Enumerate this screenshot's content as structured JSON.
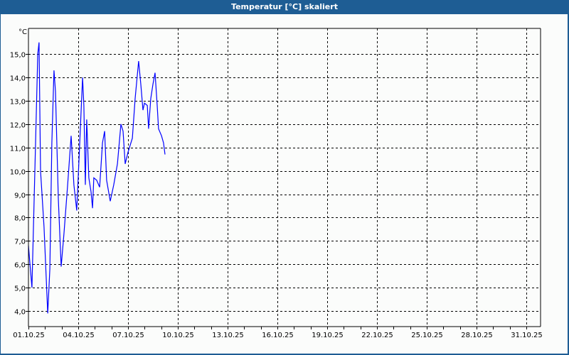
{
  "window": {
    "title": "Temperatur [°C] skaliert"
  },
  "chart_data": {
    "type": "line",
    "title": "Temperatur [°C] skaliert",
    "ylabel": "°C",
    "xlabel": "",
    "x_unit": "days since 01.10.25",
    "xlim": [
      0,
      30.86
    ],
    "ylim": [
      3.33,
      16.1
    ],
    "grid": true,
    "y_ticks": [
      {
        "value": 4,
        "label": "4,0"
      },
      {
        "value": 5,
        "label": "5,0"
      },
      {
        "value": 6,
        "label": "6,0"
      },
      {
        "value": 7,
        "label": "7,0"
      },
      {
        "value": 8,
        "label": "8,0"
      },
      {
        "value": 9,
        "label": "9,0"
      },
      {
        "value": 10,
        "label": "10,0"
      },
      {
        "value": 11,
        "label": "11,0"
      },
      {
        "value": 12,
        "label": "12,0"
      },
      {
        "value": 13,
        "label": "13,0"
      },
      {
        "value": 14,
        "label": "14,0"
      },
      {
        "value": 15,
        "label": "15,0"
      }
    ],
    "x_ticks": [
      {
        "value": 0,
        "label": "01.10.25"
      },
      {
        "value": 3,
        "label": "04.10.25"
      },
      {
        "value": 6,
        "label": "07.10.25"
      },
      {
        "value": 9,
        "label": "10.10.25"
      },
      {
        "value": 12,
        "label": "13.10.25"
      },
      {
        "value": 15,
        "label": "16.10.25"
      },
      {
        "value": 18,
        "label": "19.10.25"
      },
      {
        "value": 21,
        "label": "22.10.25"
      },
      {
        "value": 24,
        "label": "25.10.25"
      },
      {
        "value": 27,
        "label": "28.10.25"
      },
      {
        "value": 30,
        "label": "31.10.25"
      }
    ],
    "series": [
      {
        "name": "Temperatur",
        "color": "#0000ff",
        "points": [
          [
            0,
            6.8
          ],
          [
            0.21,
            5.0
          ],
          [
            0.43,
            11.2
          ],
          [
            0.56,
            15.0
          ],
          [
            0.64,
            15.5
          ],
          [
            0.73,
            10.0
          ],
          [
            0.94,
            7.6
          ],
          [
            1.16,
            3.9
          ],
          [
            1.29,
            5.8
          ],
          [
            1.41,
            11.2
          ],
          [
            1.54,
            14.3
          ],
          [
            1.63,
            13.4
          ],
          [
            1.8,
            8.8
          ],
          [
            1.97,
            5.9
          ],
          [
            2.14,
            7.3
          ],
          [
            2.36,
            9.4
          ],
          [
            2.57,
            11.5
          ],
          [
            2.74,
            9.4
          ],
          [
            2.91,
            8.3
          ],
          [
            3.09,
            11.2
          ],
          [
            3.26,
            14.0
          ],
          [
            3.34,
            12.8
          ],
          [
            3.43,
            9.4
          ],
          [
            3.51,
            12.2
          ],
          [
            3.64,
            9.7
          ],
          [
            3.77,
            9.1
          ],
          [
            3.86,
            8.4
          ],
          [
            3.94,
            9.7
          ],
          [
            4.11,
            9.6
          ],
          [
            4.29,
            9.3
          ],
          [
            4.46,
            11.2
          ],
          [
            4.59,
            11.7
          ],
          [
            4.71,
            9.6
          ],
          [
            4.93,
            8.7
          ],
          [
            5.14,
            9.4
          ],
          [
            5.36,
            10.3
          ],
          [
            5.57,
            12.0
          ],
          [
            5.7,
            11.7
          ],
          [
            5.83,
            10.3
          ],
          [
            6.0,
            10.8
          ],
          [
            6.26,
            11.4
          ],
          [
            6.43,
            13.1
          ],
          [
            6.64,
            14.7
          ],
          [
            6.77,
            13.7
          ],
          [
            6.9,
            12.6
          ],
          [
            6.99,
            12.9
          ],
          [
            7.16,
            12.8
          ],
          [
            7.24,
            11.8
          ],
          [
            7.37,
            13.1
          ],
          [
            7.5,
            13.7
          ],
          [
            7.63,
            14.2
          ],
          [
            7.76,
            12.8
          ],
          [
            7.84,
            11.8
          ],
          [
            8.02,
            11.5
          ],
          [
            8.14,
            11.2
          ],
          [
            8.23,
            10.7
          ]
        ]
      }
    ]
  }
}
